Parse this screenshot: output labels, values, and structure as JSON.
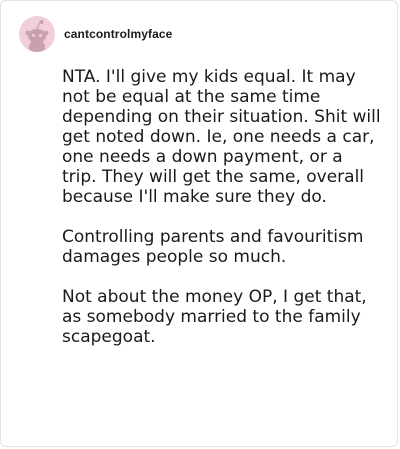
{
  "post": {
    "username": "cantcontrolmyface",
    "avatar_icon": "reddit-snoo-avatar-icon",
    "paragraphs": [
      "NTA. I'll give my kids equal. It may not be equal at the same time depending on their situation. Shit will get noted down. Ie, one needs a car, one needs a down payment, or a trip. They will get the same, overall because I'll make sure they do.",
      "Controlling parents and favouritism damages people so much.",
      "Not about the money OP, I get that, as somebody married to the family scapegoat."
    ]
  },
  "colors": {
    "avatar_bg": "#f1cfd8",
    "text": "#1a1a1a",
    "border": "#e3e3e3"
  }
}
